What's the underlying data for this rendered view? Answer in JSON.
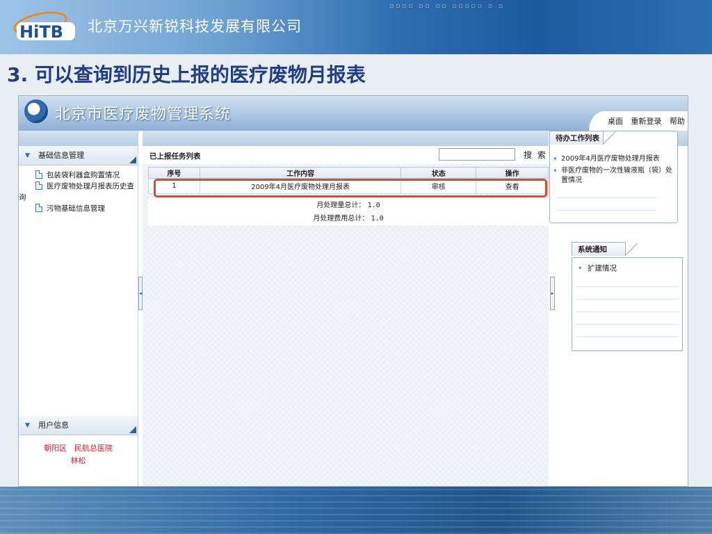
{
  "slide": {
    "company": "北京万兴新锐科技发展有限公司",
    "title": "3. 可以查询到历史上报的医疗废物月报表"
  },
  "app": {
    "title": "北京市医疗废物管理系统",
    "links": [
      "桌面",
      "重新登录",
      "帮助"
    ]
  },
  "left_panel": {
    "section1": "基础信息管理",
    "items": [
      "包装袋利器盒购置情况",
      "医疗废物处理月报表历史查询",
      "污物基础信息管理"
    ],
    "section2": "用户信息",
    "user_district": "朝阳区",
    "user_org": "民航总医院",
    "user_name": "林松"
  },
  "center": {
    "list_title": "已上报任务列表",
    "search_value": "",
    "search_label": "搜 索",
    "columns": [
      "序号",
      "工作内容",
      "状态",
      "操作"
    ],
    "rows": [
      {
        "index": "1",
        "content": "2009年4月医疗废物处理月报表",
        "status": "审核",
        "action": "查看"
      }
    ],
    "summary": [
      {
        "label": "月处理量总计：",
        "value": "1.0"
      },
      {
        "label": "月处理费用总计：",
        "value": "1.0"
      }
    ]
  },
  "right_panel": {
    "todo_title": "待办工作列表",
    "todo_items": [
      "2009年4月医疗废物处理月报表",
      "非医疗废物的一次性输液瓶（袋）处置情况"
    ],
    "notice_title": "系统通知",
    "notice_items": [
      "扩建情况"
    ]
  },
  "colors": {
    "slide_title": "#1f3c88",
    "highlight": "#e8471f",
    "user_info": "#d0202c",
    "accent": "#2e6ab0"
  }
}
